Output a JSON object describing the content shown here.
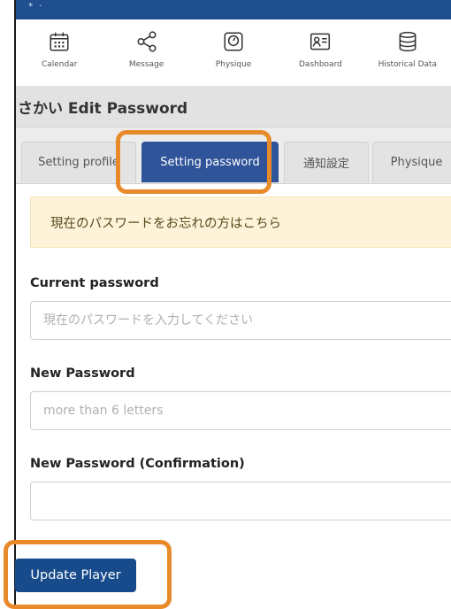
{
  "nav": {
    "items": [
      {
        "label": "Calendar",
        "icon": "calendar-icon"
      },
      {
        "label": "Message",
        "icon": "share-icon"
      },
      {
        "label": "Physique",
        "icon": "gauge-icon"
      },
      {
        "label": "Dashboard",
        "icon": "id-card-icon"
      },
      {
        "label": "Historical Data",
        "icon": "database-icon"
      }
    ]
  },
  "page": {
    "title": "さかい Edit Password"
  },
  "tabs": [
    {
      "label": "Setting profile",
      "active": false
    },
    {
      "label": "Setting password",
      "active": true
    },
    {
      "label": "通知設定",
      "active": false
    },
    {
      "label": "Physique",
      "active": false
    }
  ],
  "alert": {
    "text": "現在のパスワードをお忘れの方はこちら"
  },
  "form": {
    "current": {
      "label": "Current password",
      "placeholder": "現在のパスワードを入力してください",
      "value": ""
    },
    "new": {
      "label": "New Password",
      "placeholder": "more than 6 letters",
      "value": ""
    },
    "confirm": {
      "label": "New Password (Confirmation)",
      "placeholder": "",
      "value": ""
    },
    "submit_label": "Update Player"
  },
  "colors": {
    "accent": "#2f5499",
    "button": "#174b8b",
    "highlight": "#e88a2a",
    "alert_bg": "#fdf3d8"
  }
}
